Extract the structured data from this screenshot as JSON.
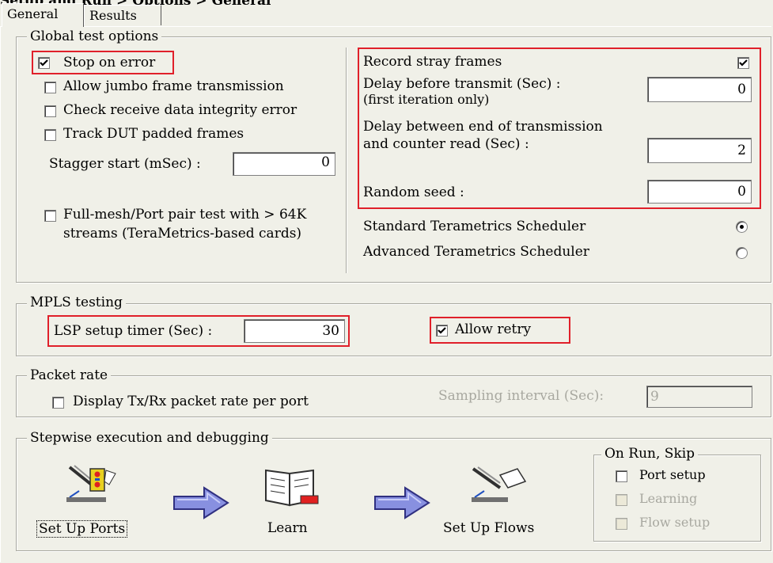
{
  "breadcrumb": "Setup and Run > Options > General",
  "tabs": [
    {
      "label": "General",
      "active": true
    },
    {
      "label": "Results",
      "active": false
    }
  ],
  "global": {
    "legend": "Global test options",
    "stop_on_error": {
      "label": "Stop on error",
      "checked": true
    },
    "allow_jumbo": {
      "label": "Allow jumbo frame transmission",
      "checked": false
    },
    "check_integrity": {
      "label": "Check receive data integrity error",
      "checked": false
    },
    "track_dut": {
      "label": "Track DUT padded frames",
      "checked": false
    },
    "stagger_label": "Stagger start (mSec) :",
    "stagger_value": "0",
    "full_mesh_line1": "Full-mesh/Port pair test with > 64K",
    "full_mesh_line2": "streams (TeraMetrics-based cards)",
    "record_stray": {
      "label": "Record stray frames",
      "checked": true
    },
    "delay_transmit_line1": "Delay before transmit (Sec) :",
    "delay_transmit_line2": "(first iteration only)",
    "delay_transmit_value": "0",
    "delay_counter_line1": "Delay between end of transmission",
    "delay_counter_line2": "and counter read (Sec) :",
    "delay_counter_value": "2",
    "random_seed_label": "Random seed :",
    "random_seed_value": "0",
    "standard_scheduler": {
      "label": "Standard Terametrics Scheduler",
      "selected": true
    },
    "advanced_scheduler": {
      "label": "Advanced Terametrics Scheduler",
      "selected": false
    }
  },
  "mpls": {
    "legend": "MPLS testing",
    "lsp_label": "LSP setup timer (Sec) :",
    "lsp_value": "30",
    "allow_retry": {
      "label": "Allow retry",
      "checked": true
    }
  },
  "packet_rate": {
    "legend": "Packet rate",
    "display_rate": {
      "label": "Display Tx/Rx packet rate per port",
      "checked": false
    },
    "sampling_label": "Sampling interval (Sec):",
    "sampling_value": "9"
  },
  "stepwise": {
    "legend": "Stepwise execution and debugging",
    "set_up_ports": "Set Up Ports",
    "learn": "Learn",
    "set_up_flows": "Set Up Flows",
    "on_run_legend": "On Run, Skip",
    "port_setup": {
      "label": "Port setup",
      "checked": false
    },
    "learning": {
      "label": "Learning",
      "checked": false
    },
    "flow_setup": {
      "label": "Flow setup",
      "checked": false
    }
  },
  "colors": {
    "highlight": "#e0202a",
    "arrow": "#3a3aa0",
    "dialog_bg": "#f0f0e8"
  }
}
